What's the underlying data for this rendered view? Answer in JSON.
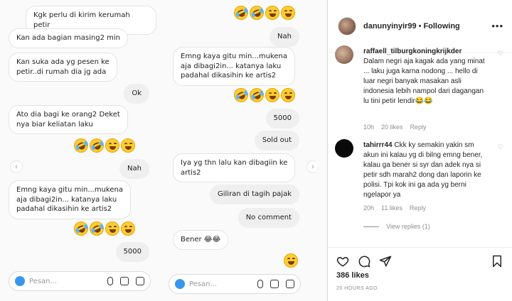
{
  "chat_left": {
    "messages": [
      {
        "text": "Kgk perlu di kirim kerumah petir",
        "side": "in"
      },
      {
        "text": "Kan ada bagian masing2 min",
        "side": "in"
      },
      {
        "text": "Kan suka ada yg pesen ke\npetir..di rumah dia jg ada",
        "side": "in"
      },
      {
        "text": "Ok",
        "side": "out"
      },
      {
        "text": "Ato dia bagi ke orang2 Deket\nnya biar keliatan laku",
        "side": "in"
      },
      {
        "text": "Nah",
        "side": "out"
      },
      {
        "text": "Emng kaya gitu min...mukena\naja dibagi2in... katanya laku\npadahal dikasihin ke artis2",
        "side": "in"
      },
      {
        "text": "5000",
        "side": "out"
      }
    ],
    "composer_placeholder": "Pesan..."
  },
  "chat_right": {
    "messages": [
      {
        "text": "Nah",
        "side": "out"
      },
      {
        "text": "Emng kaya gitu min...mukena\naja dibagi2in... katanya laku\npadahal dikasihin ke artis2",
        "side": "in"
      },
      {
        "text": "5000",
        "side": "out"
      },
      {
        "text": "Sold out",
        "side": "out"
      },
      {
        "text": "Iya yg thn lalu kan dibagiin ke\nartis2",
        "side": "in"
      },
      {
        "text": "Giliran di tagih pajak",
        "side": "out"
      },
      {
        "text": "No comment",
        "side": "out"
      },
      {
        "text": "Bener 😂😂",
        "side": "in"
      }
    ],
    "composer_placeholder": "Pesan..."
  },
  "post": {
    "username": "danunyinyir99",
    "separator": "•",
    "follow_status": "Following",
    "more": "•••",
    "likes": "386 likes",
    "time": "20 HOURS AGO"
  },
  "comments": [
    {
      "username": "raffaell_tilburgkoningkrijkder",
      "text": "Dalam negri aja kagak ada yang minat ... laku juga karna nodong ... hello di luar negri banyak masakan asli indonesia lebih nampol dari dagangan lu tini petir lendir😂😂",
      "age": "10h",
      "likes": "20 likes",
      "reply": "Reply"
    },
    {
      "username": "tahirrr44",
      "text": "Ckk ky semakin yakin sm akun ini kalau yg di bilng emng bener, kalau ga bener si syr dan adek nya si petir sdh marah2 dong dan laporin ke polisi. Tpi kok ini ga ada yg berni ngelapor ya",
      "age": "20h",
      "likes": "11 likes",
      "reply": "Reply",
      "view_replies": "View replies (1)"
    }
  ],
  "colors": {
    "accent": "#3797f0",
    "emoji": "#ffcc33",
    "muted": "#8e8e8e"
  }
}
